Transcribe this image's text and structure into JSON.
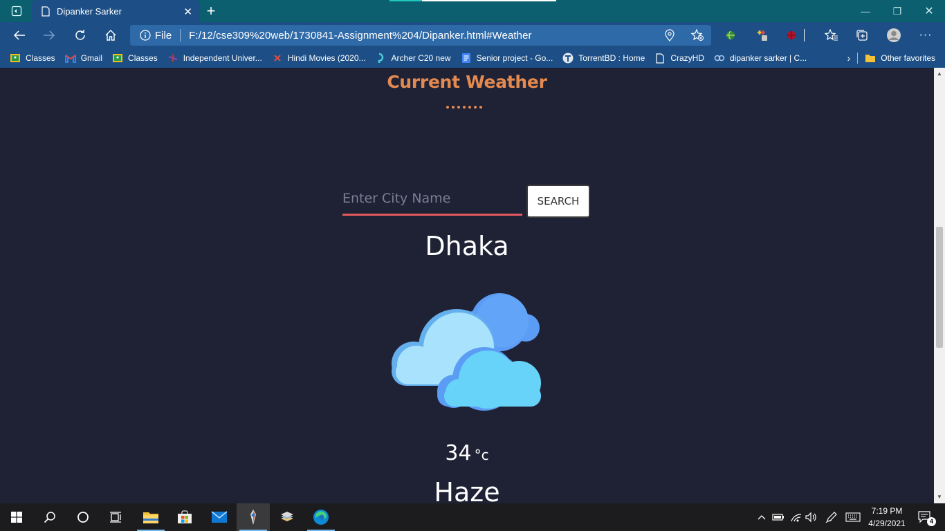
{
  "browser": {
    "tab_title": "Dipanker Sarker",
    "address_label": "File",
    "url": "F:/12/cse309%20web/1730841-Assignment%204/Dipanker.html#Weather"
  },
  "bookmarks": [
    {
      "label": "Classes",
      "icon": "classroom-icon"
    },
    {
      "label": "Gmail",
      "icon": "gmail-icon"
    },
    {
      "label": "Classes",
      "icon": "classroom-icon"
    },
    {
      "label": "Independent Univer...",
      "icon": "university-icon"
    },
    {
      "label": "Hindi Movies (2020...",
      "icon": "movie-icon"
    },
    {
      "label": "Archer C20 new",
      "icon": "tplink-icon"
    },
    {
      "label": "Senior project - Go...",
      "icon": "docs-icon"
    },
    {
      "label": "TorrentBD : Home",
      "icon": "torrent-icon"
    },
    {
      "label": "CrazyHD",
      "icon": "page-icon"
    },
    {
      "label": "dipanker sarker | C...",
      "icon": "link-icon"
    }
  ],
  "other_favorites": "Other favorites",
  "page": {
    "heading": "Current Weather",
    "search_placeholder": "Enter City Name",
    "search_button": "SEARCH",
    "city": "Dhaka",
    "temperature": "34",
    "unit": "°c",
    "condition": "Haze"
  },
  "taskbar": {
    "time": "7:19 PM",
    "date": "4/29/2021",
    "notification_count": "4"
  },
  "colors": {
    "accent_heading": "#e4894f",
    "input_underline": "#e3595d",
    "page_background": "#1f2235",
    "browser_chrome": "#1d4f86"
  }
}
